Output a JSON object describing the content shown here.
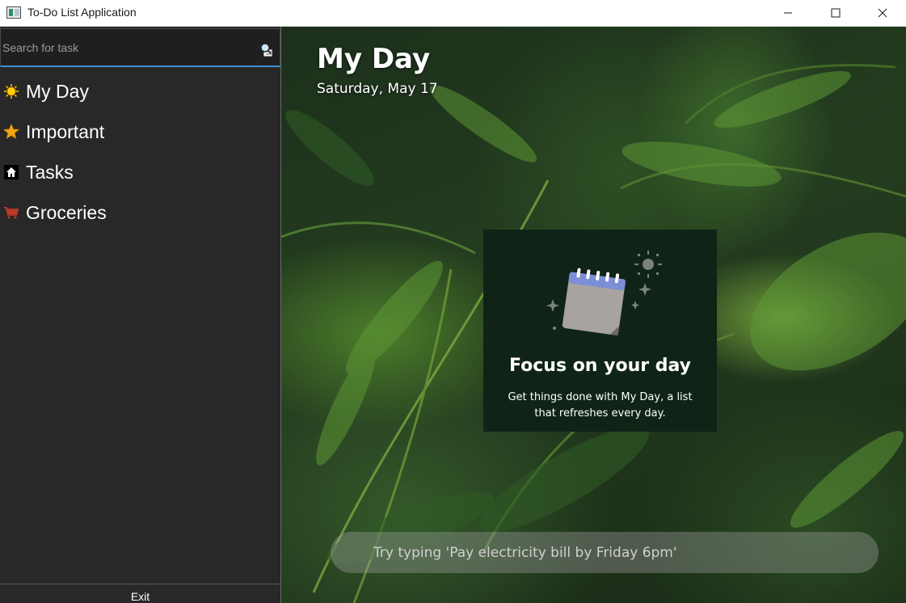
{
  "window": {
    "title": "To-Do List Application",
    "controls": [
      "minimize",
      "maximize",
      "close"
    ]
  },
  "sidebar": {
    "search": {
      "value": "",
      "placeholder": "Search for task",
      "icon": "search-icon"
    },
    "items": [
      {
        "label": "My Day",
        "icon": "sun-icon"
      },
      {
        "label": "Important",
        "icon": "star-icon"
      },
      {
        "label": "Tasks",
        "icon": "home-icon"
      },
      {
        "label": "Groceries",
        "icon": "cart-icon"
      }
    ],
    "exit_label": "Exit"
  },
  "main": {
    "title": "My Day",
    "date": "Saturday, May 17",
    "focus_card": {
      "title": "Focus on your day",
      "description": "Get things done with My Day, a list that refreshes every day.",
      "illustration": "calendar-icon"
    },
    "add_task": {
      "value": "",
      "placeholder": "Try typing 'Pay electricity bill by Friday 6pm'"
    }
  },
  "colors": {
    "sidebar_bg": "#282828",
    "search_accent": "#3d8fd6",
    "card_bg": "#0f2417",
    "sun": "#f5b400",
    "star": "#f2a516",
    "cart": "#c0392b"
  }
}
